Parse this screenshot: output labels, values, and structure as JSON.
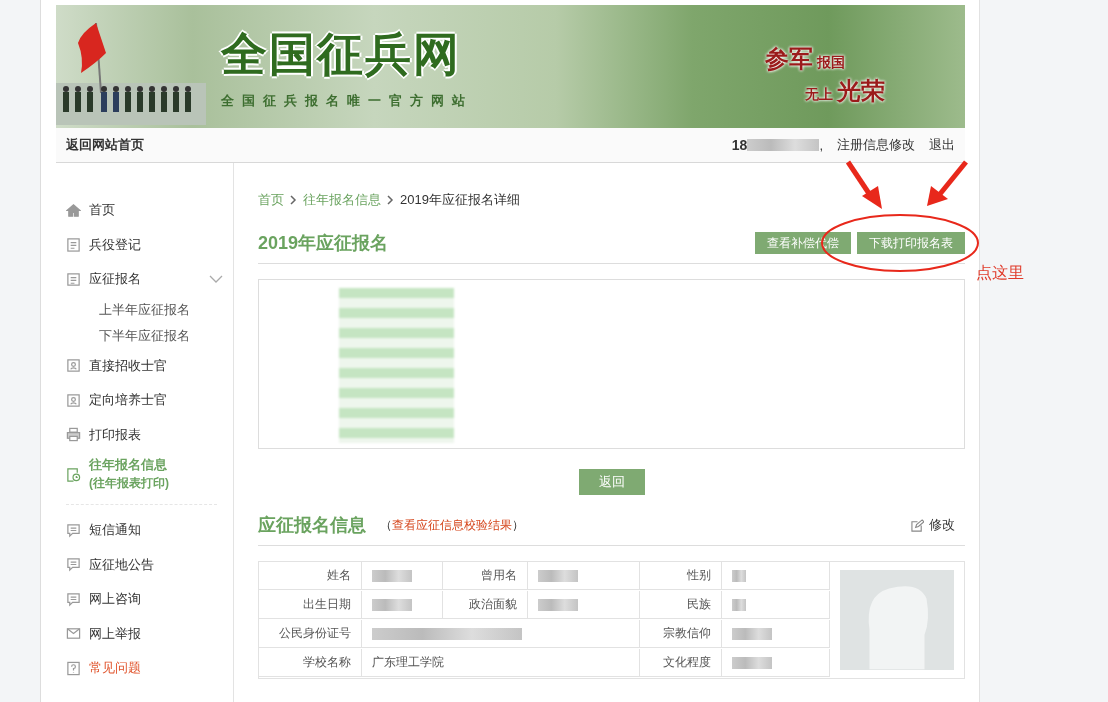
{
  "banner": {
    "title": "全国征兵网",
    "subtitle": "全国征兵报名唯一官方网站",
    "slogan": [
      "参军",
      "报国",
      "无上",
      "光荣"
    ]
  },
  "topbar": {
    "home_link": "返回网站首页",
    "user_prefix": "18",
    "user_suffix": ",",
    "links": [
      "注册信息修改",
      "退出"
    ]
  },
  "sidebar": {
    "groups": [
      [
        {
          "label": "首页",
          "selected": false,
          "emphasis": false
        },
        {
          "label": "兵役登记",
          "selected": false,
          "emphasis": false
        },
        {
          "label": "应征报名",
          "selected": false,
          "emphasis": false,
          "expanded": true,
          "children": [
            {
              "label": "上半年应征报名",
              "selected": false
            },
            {
              "label": "下半年应征报名",
              "selected": false
            }
          ]
        },
        {
          "label": "直接招收士官",
          "selected": false,
          "emphasis": false
        },
        {
          "label": "定向培养士官",
          "selected": false,
          "emphasis": false
        },
        {
          "label": "打印报表",
          "selected": false,
          "emphasis": false
        },
        {
          "label": "往年报名信息",
          "note": "(往年报表打印)",
          "selected": true,
          "emphasis": false
        }
      ],
      [
        {
          "label": "短信通知",
          "selected": false,
          "emphasis": false
        },
        {
          "label": "应征地公告",
          "selected": false,
          "emphasis": false
        },
        {
          "label": "网上咨询",
          "selected": false,
          "emphasis": false
        },
        {
          "label": "网上举报",
          "selected": false,
          "emphasis": false
        },
        {
          "label": "常见问题",
          "selected": false,
          "emphasis": true
        }
      ]
    ]
  },
  "breadcrumb": [
    "首页",
    "往年报名信息",
    "2019年应征报名详细"
  ],
  "record": {
    "title": "2019年应征报名",
    "buttons": [
      "查看补偿代偿",
      "下载打印报名表"
    ],
    "back_button": "返回"
  },
  "info": {
    "title": "应征报名信息",
    "note_open": "（",
    "note_link": "查看应征信息校验结果",
    "note_close": "）",
    "edit": "修改",
    "rows": [
      [
        {
          "label": "姓名",
          "redacted": true,
          "wide": false
        },
        {
          "label": "曾用名",
          "redacted": true,
          "wide": false
        },
        {
          "label": "性别",
          "redacted": true,
          "wide": false
        }
      ],
      [
        {
          "label": "出生日期",
          "redacted": true,
          "wide": false
        },
        {
          "label": "政治面貌",
          "redacted": true,
          "wide": false
        },
        {
          "label": "民族",
          "redacted": true,
          "wide": false
        }
      ],
      [
        {
          "label": "公民身份证号",
          "redacted": true,
          "wide": true
        },
        {
          "label": "宗教信仰",
          "redacted": true,
          "wide": false
        }
      ],
      [
        {
          "label": "学校名称",
          "value": "广东理工学院",
          "redacted": false,
          "wide": true
        },
        {
          "label": "文化程度",
          "redacted": true,
          "wide": false
        }
      ]
    ]
  },
  "annotation": {
    "text": "点这里"
  }
}
